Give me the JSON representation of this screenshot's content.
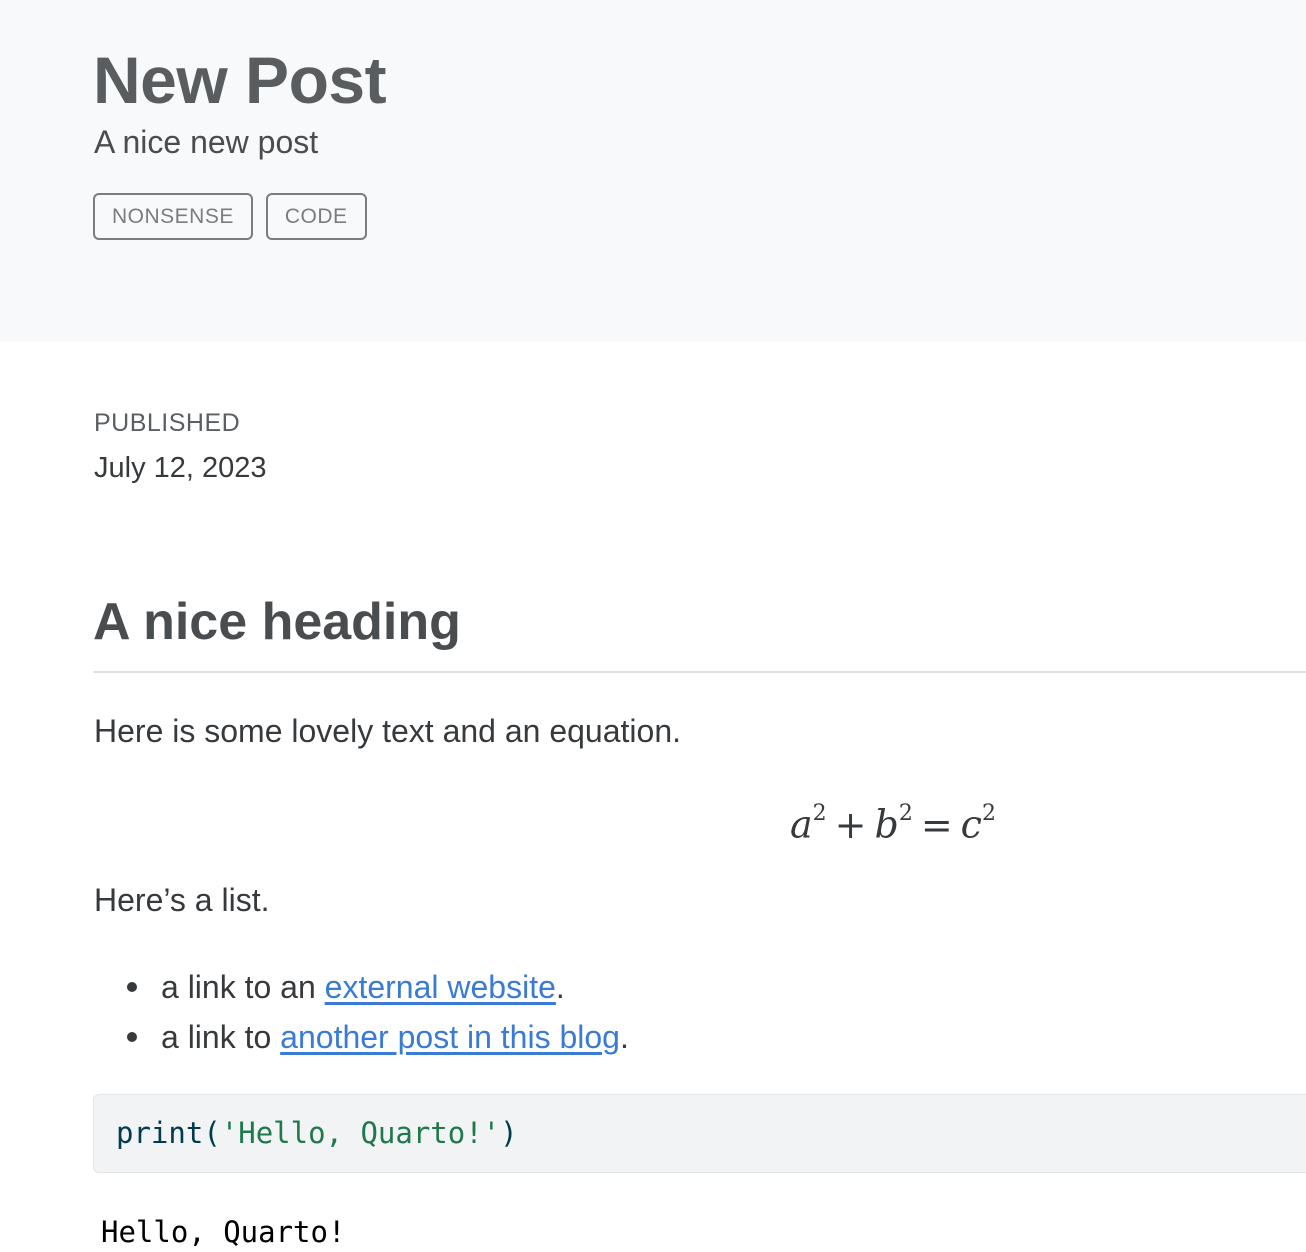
{
  "header": {
    "title": "New Post",
    "subtitle": "A nice new post",
    "categories": [
      "NONSENSE",
      "CODE"
    ]
  },
  "meta": {
    "published_label": "PUBLISHED",
    "published_date": "July 12, 2023"
  },
  "content": {
    "heading": "A nice heading",
    "intro_text": "Here is some lovely text and an equation.",
    "equation": {
      "a": "a",
      "b": "b",
      "c": "c",
      "exponent": "2",
      "plus": "+",
      "equals": "="
    },
    "list_intro": "Here’s a list.",
    "list_items": [
      {
        "prefix": "a link to an ",
        "link_text": "external website",
        "suffix": "."
      },
      {
        "prefix": "a link to ",
        "link_text": "another post in this blog",
        "suffix": "."
      }
    ],
    "code": {
      "function": "print",
      "open_paren": "(",
      "string": "'Hello, Quarto!'",
      "close_paren": ")"
    },
    "output": "Hello, Quarto!"
  },
  "colors": {
    "banner_background": "#f8f9fa",
    "link": "#3a7bd5",
    "code_background": "#f1f3f5",
    "code_string": "#20794d",
    "code_function": "#003b4f"
  }
}
